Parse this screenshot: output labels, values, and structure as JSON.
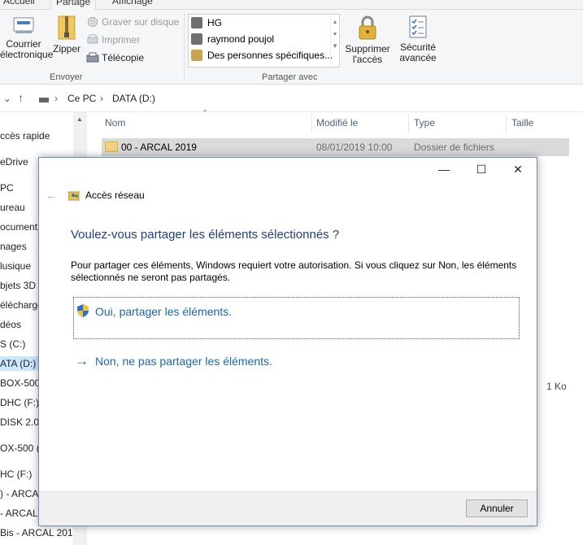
{
  "ribbon": {
    "tabs": [
      "Accueil",
      "Partage",
      "Affichage"
    ],
    "buttons": {
      "email": "Courrier\nélectronique",
      "zip": "Zipper",
      "burn": "Graver sur disque",
      "print": "Imprimer",
      "fax": "Télécopie",
      "remove_access": "Supprimer\nl'accès",
      "security": "Sécurité\navancée"
    },
    "groups": {
      "send": "Envoyer",
      "share_with": "Partager avec"
    },
    "share_list": [
      "HG",
      "raymond poujol",
      "Des personnes spécifiques..."
    ]
  },
  "address": {
    "path": [
      "Ce PC",
      "DATA (D:)"
    ]
  },
  "nav": {
    "items": [
      "ccès rapide",
      "eDrive",
      "PC",
      "ureau",
      "ocument",
      "nages",
      "lusique",
      "bjets 3D",
      "élécharge",
      "déos",
      "S (C:)",
      "ATA (D:)",
      "BOX-500",
      "DHC (F:)",
      "DISK 2.0 (",
      "OX-500 (",
      "HC (F:)",
      ") -  ARCA",
      "- ARCAL",
      "Bis - ARCAL 201"
    ],
    "selected_index": 11
  },
  "files": {
    "columns": [
      "Nom",
      "Modifié le",
      "Type",
      "Taille"
    ],
    "rows": [
      {
        "name": "00 - ARCAL 2019",
        "modified": "08/01/2019 10:00",
        "type": "Dossier de fichiers",
        "size": ""
      }
    ],
    "partial_size": "1 Ko"
  },
  "dialog": {
    "title": "Accès réseau",
    "question": "Voulez-vous partager les éléments sélectionnés ?",
    "description": "Pour partager ces éléments, Windows requiert votre autorisation. Si vous cliquez sur Non, les éléments sélectionnés ne seront pas partagés.",
    "yes_option": "Oui, partager les éléments.",
    "no_option": "Non, ne pas partager les éléments.",
    "cancel": "Annuler"
  },
  "colors": {
    "link": "#1b66b3",
    "heading": "#1e3f8c",
    "selection": "#cce8ff"
  }
}
